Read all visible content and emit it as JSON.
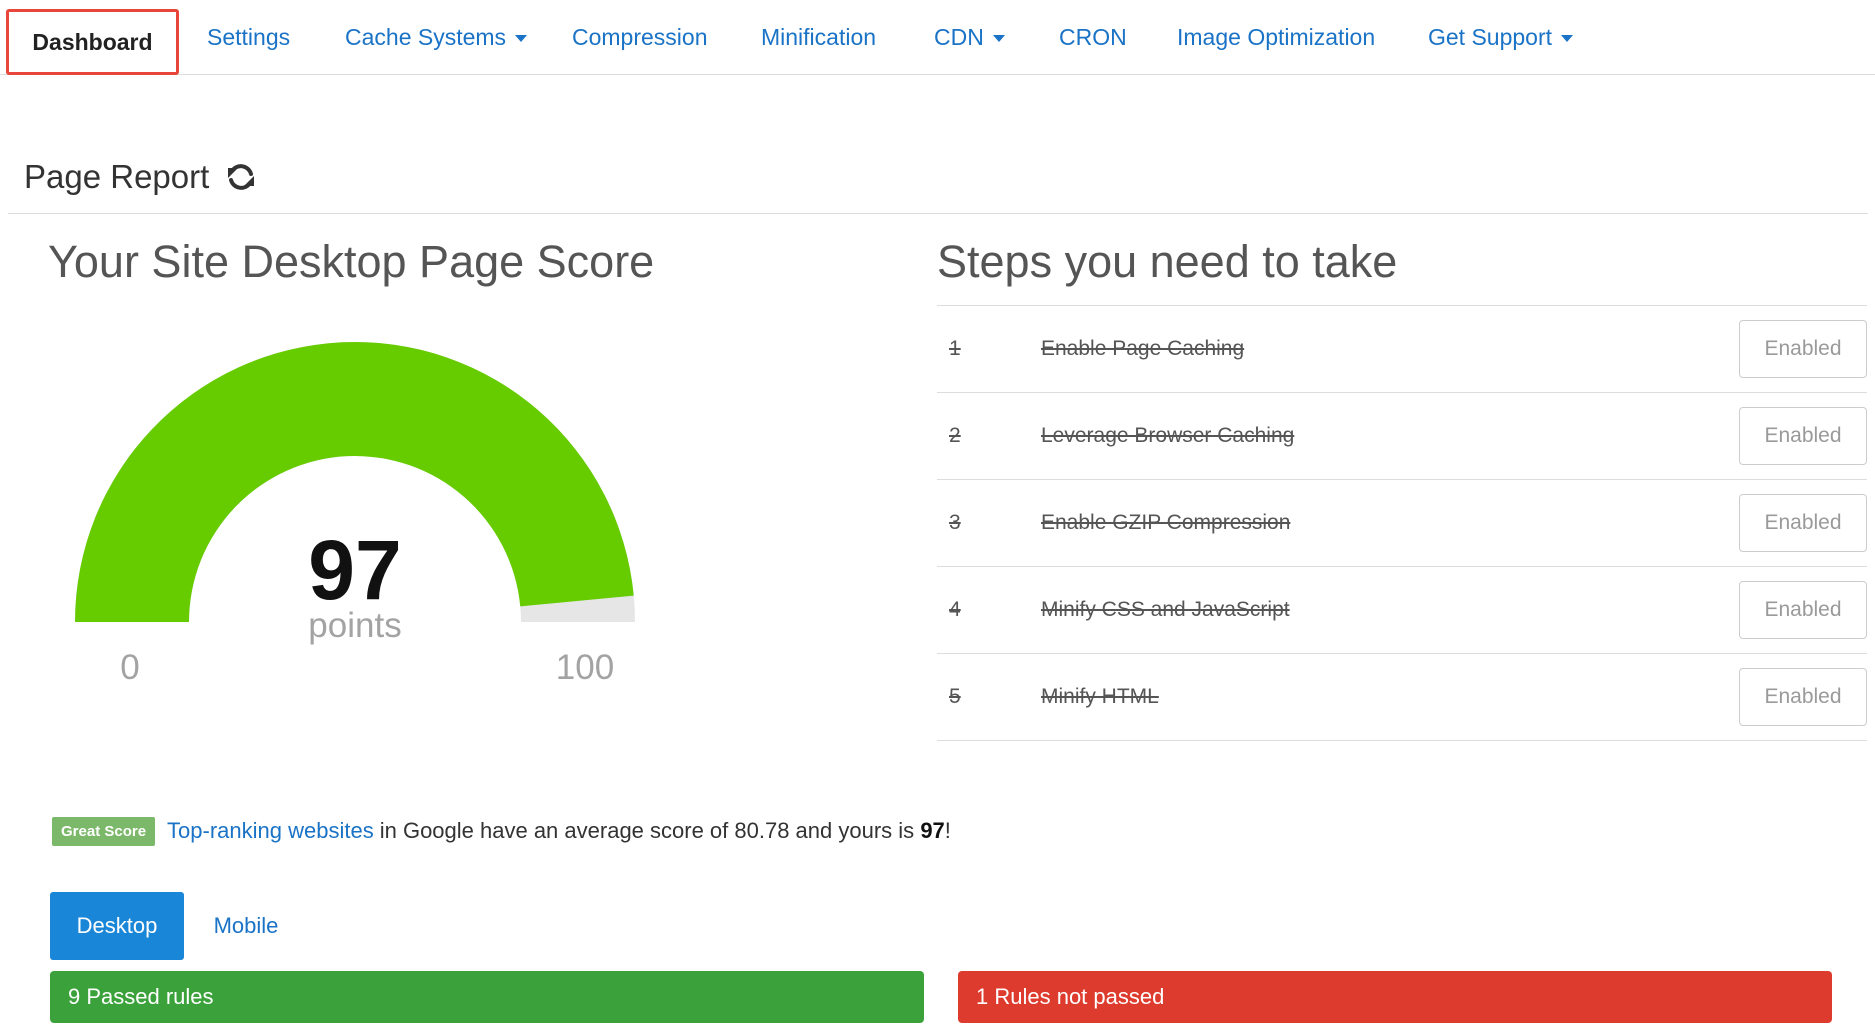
{
  "nav": {
    "active": "Dashboard",
    "items": [
      {
        "label": "Settings",
        "dropdown": false
      },
      {
        "label": "Cache Systems",
        "dropdown": true
      },
      {
        "label": "Compression",
        "dropdown": false
      },
      {
        "label": "Minification",
        "dropdown": false
      },
      {
        "label": "CDN",
        "dropdown": true
      },
      {
        "label": "CRON",
        "dropdown": false
      },
      {
        "label": "Image Optimization",
        "dropdown": false
      },
      {
        "label": "Get Support",
        "dropdown": true
      }
    ]
  },
  "report": {
    "title": "Page Report",
    "refresh_icon": "refresh-icon"
  },
  "score": {
    "title": "Your Site Desktop Page Score",
    "value": 97,
    "value_text": "97",
    "unit": "points",
    "min": "0",
    "max": "100",
    "gauge_max": 100,
    "fill_color": "#66cc00",
    "track_color": "#e6e6e6"
  },
  "steps": {
    "title": "Steps you need to take",
    "items": [
      {
        "num": "1",
        "label": "Enable Page Caching",
        "status": "Enabled"
      },
      {
        "num": "2",
        "label": "Leverage Browser Caching",
        "status": "Enabled"
      },
      {
        "num": "3",
        "label": "Enable GZIP Compression",
        "status": "Enabled"
      },
      {
        "num": "4",
        "label": "Minify CSS and JavaScript",
        "status": "Enabled"
      },
      {
        "num": "5",
        "label": "Minify HTML",
        "status": "Enabled"
      }
    ]
  },
  "note": {
    "badge": "Great Score",
    "link": "Top-ranking websites",
    "text": "in Google have an average score of 80.78 and yours is",
    "score": "97",
    "end": "!"
  },
  "tabs": {
    "desktop": "Desktop",
    "mobile": "Mobile"
  },
  "results": {
    "passed": "9 Passed rules",
    "failed": "1 Rules not passed"
  },
  "colors": {
    "accent": "#1a73c6",
    "active_border": "#e8463a",
    "pass": "#3ba23b",
    "fail": "#de3b2f",
    "badge": "#7cb86a"
  }
}
